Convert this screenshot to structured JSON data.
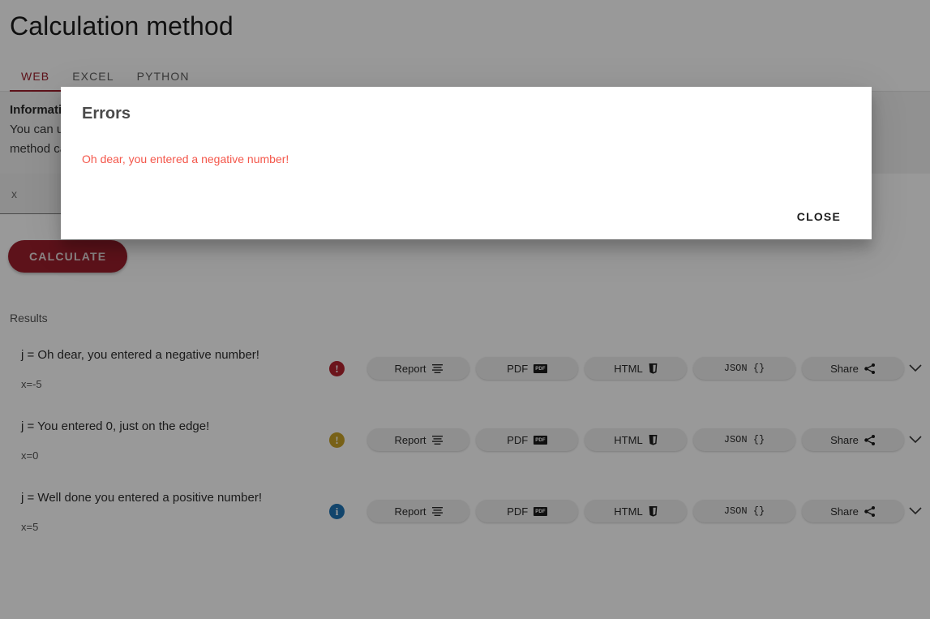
{
  "page": {
    "title": "Calculation method",
    "tabs": [
      {
        "label": "WEB",
        "active": true
      },
      {
        "label": "EXCEL",
        "active": false
      },
      {
        "label": "PYTHON",
        "active": false
      }
    ],
    "info": {
      "heading": "Information",
      "body": "You can use this page to run the calculation. The results are displayed below. More information about the method can be found above."
    },
    "input": {
      "placeholder": "x",
      "value": ""
    },
    "calculate_label": "CALCULATE",
    "results_label": "Results"
  },
  "actions": {
    "report": "Report",
    "pdf": "PDF",
    "html": "HTML",
    "json": "JSON {}",
    "share": "Share",
    "pdf_glyph": "PDF",
    "html_glyph": "5"
  },
  "results": [
    {
      "title": "j = Oh dear, you entered a negative number!",
      "sub": "x=-5",
      "status": "error",
      "status_glyph": "!",
      "status_color": "#b52430"
    },
    {
      "title": "j = You entered 0, just on the edge!",
      "sub": "x=0",
      "status": "warning",
      "status_glyph": "!",
      "status_color": "#c9a227"
    },
    {
      "title": "j = Well done you entered a positive number!",
      "sub": "x=5",
      "status": "info",
      "status_glyph": "i",
      "status_color": "#1f74b5"
    }
  ],
  "modal": {
    "title": "Errors",
    "message": "Oh dear, you entered a negative number!",
    "close_label": "CLOSE",
    "message_color": "#f4574b"
  },
  "theme": {
    "accent": "#9c1f2c",
    "overlay": "rgba(0,0,0,0.40)"
  }
}
